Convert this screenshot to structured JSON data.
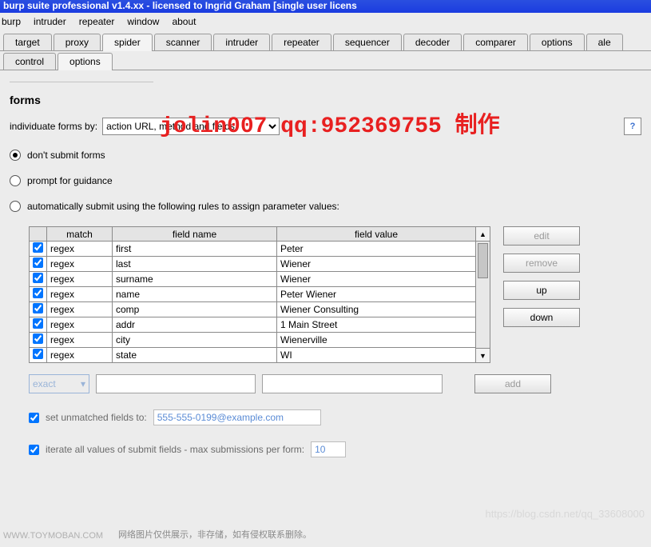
{
  "title_bar": "burp suite professional v1.4.xx  - licensed to Ingrid Graham [single user licens",
  "menu": [
    "burp",
    "intruder",
    "repeater",
    "window",
    "about"
  ],
  "tabs_main": [
    "target",
    "proxy",
    "spider",
    "scanner",
    "intruder",
    "repeater",
    "sequencer",
    "decoder",
    "comparer",
    "options",
    "ale"
  ],
  "tabs_main_active": 2,
  "tabs_sub": [
    "control",
    "options"
  ],
  "tabs_sub_active": 1,
  "section": {
    "title": "forms"
  },
  "individuate": {
    "label": "individuate forms by:",
    "value": "action URL, method and fields"
  },
  "radios": {
    "dont_submit": "don't submit forms",
    "prompt": "prompt for guidance",
    "auto": "automatically submit using the following rules to assign parameter values:",
    "selected": "dont_submit"
  },
  "table": {
    "headers": [
      "",
      "match",
      "field name",
      "field value"
    ],
    "rows": [
      {
        "checked": true,
        "match": "regex",
        "name": "first",
        "value": "Peter"
      },
      {
        "checked": true,
        "match": "regex",
        "name": "last",
        "value": "Wiener"
      },
      {
        "checked": true,
        "match": "regex",
        "name": "surname",
        "value": "Wiener"
      },
      {
        "checked": true,
        "match": "regex",
        "name": "name",
        "value": "Peter Wiener"
      },
      {
        "checked": true,
        "match": "regex",
        "name": "comp",
        "value": "Wiener Consulting"
      },
      {
        "checked": true,
        "match": "regex",
        "name": "addr",
        "value": "1 Main Street"
      },
      {
        "checked": true,
        "match": "regex",
        "name": "city",
        "value": "Wienerville"
      },
      {
        "checked": true,
        "match": "regex",
        "name": "state",
        "value": "WI"
      }
    ]
  },
  "buttons": {
    "edit": "edit",
    "remove": "remove",
    "up": "up",
    "down": "down",
    "add": "add"
  },
  "add_row": {
    "exact": "exact",
    "name_ph": "",
    "value_ph": ""
  },
  "unmatched": {
    "label": "set unmatched fields to:",
    "value": "555-555-0199@example.com",
    "checked": true
  },
  "iterate": {
    "label": "iterate all values of submit fields - max submissions per form:",
    "value": "10",
    "checked": true
  },
  "watermark": "jolin007 qq:952369755 制作",
  "wm_csdn": "https://blog.csdn.net/qq_33608000",
  "footer_site": "WWW.TOYMOBAN.COM",
  "footer_note": "网络图片仅供展示，非存储，如有侵权联系删除。"
}
